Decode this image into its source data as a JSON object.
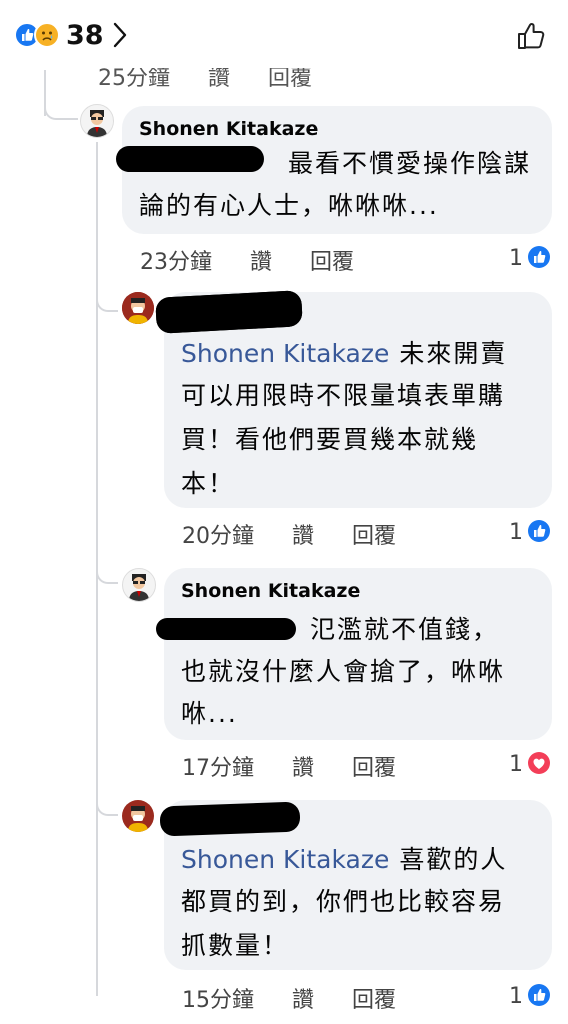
{
  "header": {
    "reaction_count": "38",
    "reaction_icons": [
      "like-icon",
      "sad-icon"
    ]
  },
  "previous": {
    "time": "25分鐘",
    "like_label": "讚",
    "reply_label": "回覆"
  },
  "comments": [
    {
      "author": "Shonen Kitakaze",
      "text_line1": "最看不慣愛操作陰謀",
      "text_line2": "論的有心人士，咻咻咻...",
      "time": "23分鐘",
      "like_label": "讚",
      "reply_label": "回覆",
      "reactions": "1",
      "reaction_icon": "like-icon"
    },
    {
      "mention": "Shonen Kitakaze",
      "text_line1": "未來開賣",
      "text_line2": "可以用限時不限量填表單購",
      "text_line3": "買！看他們要買幾本就幾",
      "text_line4": "本！",
      "time": "20分鐘",
      "like_label": "讚",
      "reply_label": "回覆",
      "reactions": "1",
      "reaction_icon": "like-icon"
    },
    {
      "author": "Shonen Kitakaze",
      "text_line1": "氾濫就不值錢，",
      "text_line2": "也就沒什麼人會搶了，咻咻",
      "text_line3": "咻...",
      "time": "17分鐘",
      "like_label": "讚",
      "reply_label": "回覆",
      "reactions": "1",
      "reaction_icon": "heart-icon"
    },
    {
      "mention": "Shonen Kitakaze",
      "text_line1": "喜歡的人",
      "text_line2": "都買的到，你們也比較容易",
      "text_line3": "抓數量！",
      "time": "15分鐘",
      "like_label": "讚",
      "reply_label": "回覆",
      "reactions": "1",
      "reaction_icon": "like-icon"
    }
  ],
  "colors": {
    "bubble": "#f0f2f5",
    "mention": "#385898",
    "like_blue": "#1877f2",
    "heart_red": "#f33e58",
    "thread_line": "#d6d8dc"
  }
}
